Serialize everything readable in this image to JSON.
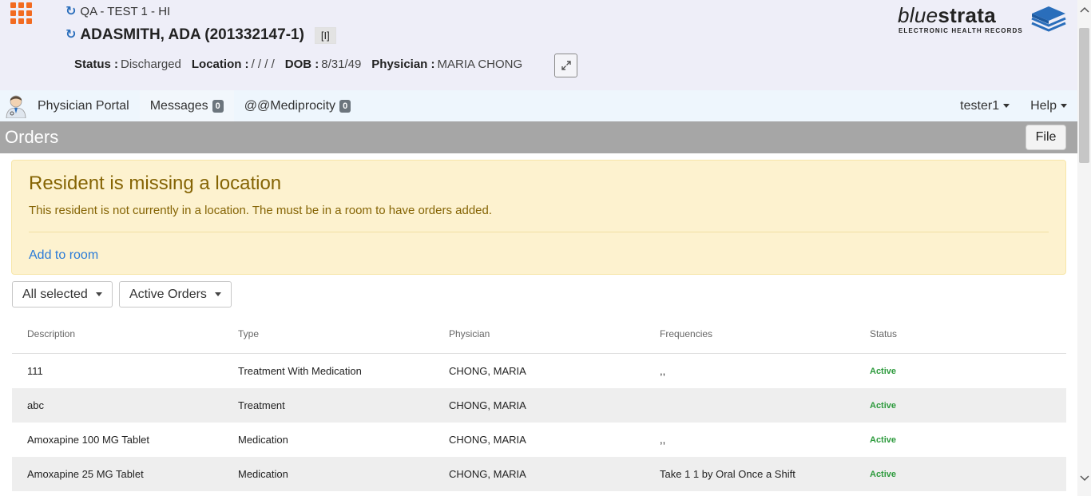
{
  "header": {
    "facility": "QA - TEST 1 - HI",
    "patient_name": "ADASMITH, ADA (201332147-1)",
    "flag": "[I]",
    "status_label": "Status :",
    "status_value": "Discharged",
    "location_label": "Location :",
    "location_value": "/ / / /",
    "dob_label": "DOB :",
    "dob_value": "8/31/49",
    "physician_label": "Physician :",
    "physician_value": "MARIA CHONG",
    "logo_main_light": "blue",
    "logo_main_bold": "strata",
    "logo_sub": "ELECTRONIC HEALTH RECORDS",
    "icons": {
      "apps": "app-grid-icon",
      "refresh": "refresh-icon",
      "expand": "expand-icon"
    },
    "colors": {
      "apps": "#f26b21",
      "refresh": "#2a6ebb",
      "logo_blue": "#2a6ebb"
    }
  },
  "navbar": {
    "portal": "Physician Portal",
    "messages": "Messages",
    "messages_count": "0",
    "mediprocity": "@@Mediprocity",
    "mediprocity_count": "0",
    "user": "tester1",
    "help": "Help"
  },
  "orders": {
    "title": "Orders",
    "file_button": "File"
  },
  "alert": {
    "title": "Resident is missing a location",
    "text": "This resident is not currently in a location. The must be in a room to have orders added.",
    "link": "Add to room"
  },
  "filters": {
    "selection": "All selected",
    "order_type": "Active Orders"
  },
  "table": {
    "columns": [
      "Description",
      "Type",
      "Physician",
      "Frequencies",
      "Status"
    ],
    "rows": [
      {
        "description": "111",
        "type": "Treatment With Medication",
        "physician": "CHONG, MARIA",
        "frequencies": ",,",
        "status": "Active"
      },
      {
        "description": "abc",
        "type": "Treatment",
        "physician": "CHONG, MARIA",
        "frequencies": "",
        "status": "Active"
      },
      {
        "description": "Amoxapine 100 MG Tablet",
        "type": "Medication",
        "physician": "CHONG, MARIA",
        "frequencies": ",,",
        "status": "Active"
      },
      {
        "description": "Amoxapine 25 MG Tablet",
        "type": "Medication",
        "physician": "CHONG, MARIA",
        "frequencies": "Take 1 1 by Oral Once a Shift",
        "status": "Active"
      }
    ]
  }
}
